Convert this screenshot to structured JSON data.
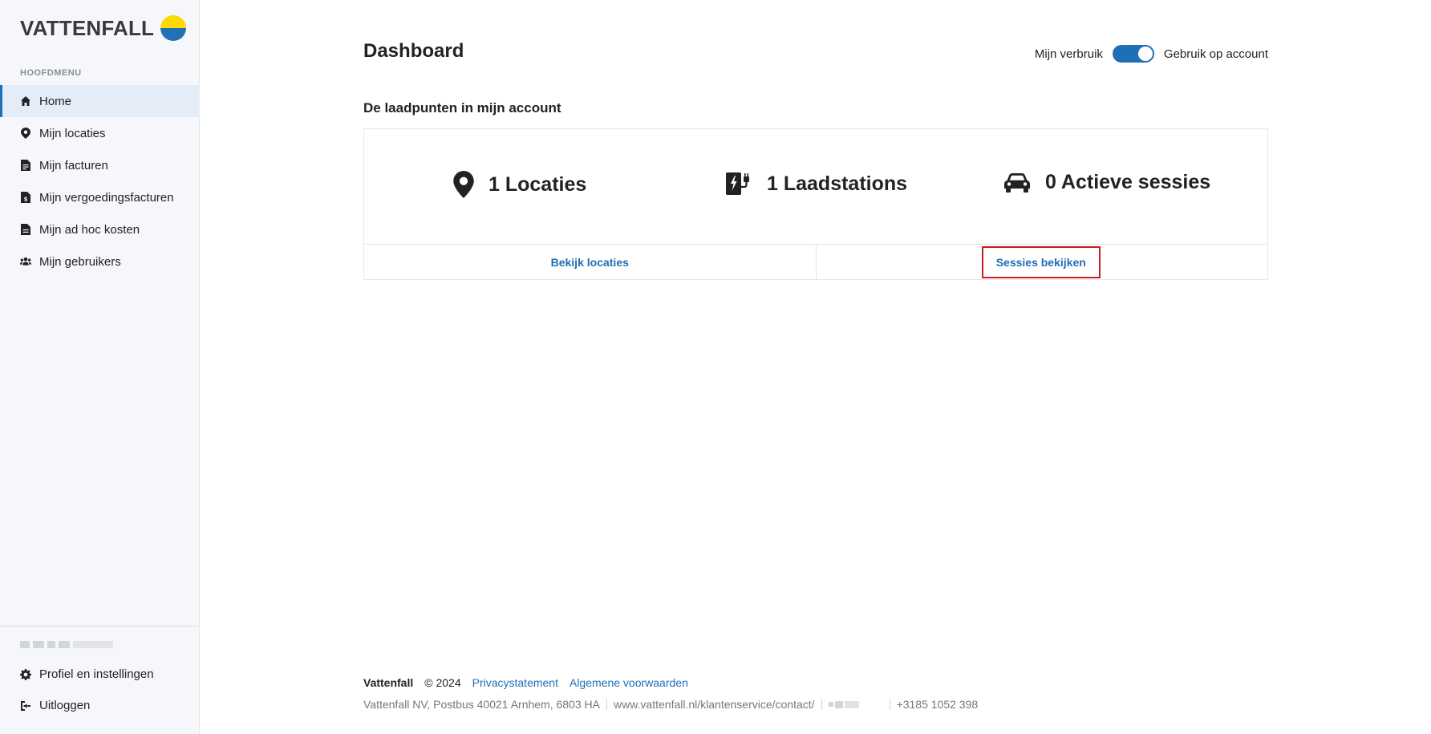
{
  "brand": {
    "logo_text": "VATTENFALL",
    "colors": {
      "yellow": "#ffda00",
      "blue": "#2071b5"
    }
  },
  "sidebar": {
    "heading": "HOOFDMENU",
    "items": [
      {
        "label": "Home",
        "icon": "home-icon",
        "active": true
      },
      {
        "label": "Mijn locaties",
        "icon": "map-pin-icon"
      },
      {
        "label": "Mijn facturen",
        "icon": "invoice-icon"
      },
      {
        "label": "Mijn vergoedingsfacturen",
        "icon": "reimbursement-invoice-icon"
      },
      {
        "label": "Mijn ad hoc kosten",
        "icon": "document-icon"
      },
      {
        "label": "Mijn gebruikers",
        "icon": "users-icon"
      }
    ],
    "bottom": {
      "profile": "Profiel en instellingen",
      "logout": "Uitloggen"
    }
  },
  "header": {
    "title": "Dashboard",
    "toggle": {
      "left_label": "Mijn verbruik",
      "right_label": "Gebruik op account",
      "on": true
    }
  },
  "section": {
    "title": "De laadpunten in mijn account",
    "stats": [
      {
        "text": "1 Locaties",
        "icon": "map-pin-icon"
      },
      {
        "text": "1 Laadstations",
        "icon": "charging-station-icon"
      },
      {
        "text": "0 Actieve sessies",
        "icon": "car-icon"
      }
    ],
    "actions": [
      {
        "label": "Bekijk locaties"
      },
      {
        "label": "Sessies bekijken",
        "highlighted": true
      }
    ]
  },
  "footer": {
    "brand": "Vattenfall",
    "copyright": "© 2024",
    "links": [
      "Privacystatement",
      "Algemene voorwaarden"
    ],
    "address": "Vattenfall NV, Postbus 40021 Arnhem, 6803 HA",
    "url": "www.vattenfall.nl/klantenservice/contact/",
    "phone": "+3185 1052 398"
  },
  "colors": {
    "accent": "#1f6fb5",
    "highlight_border": "#cc1a1a",
    "sidebar_bg": "#f5f7fb"
  }
}
